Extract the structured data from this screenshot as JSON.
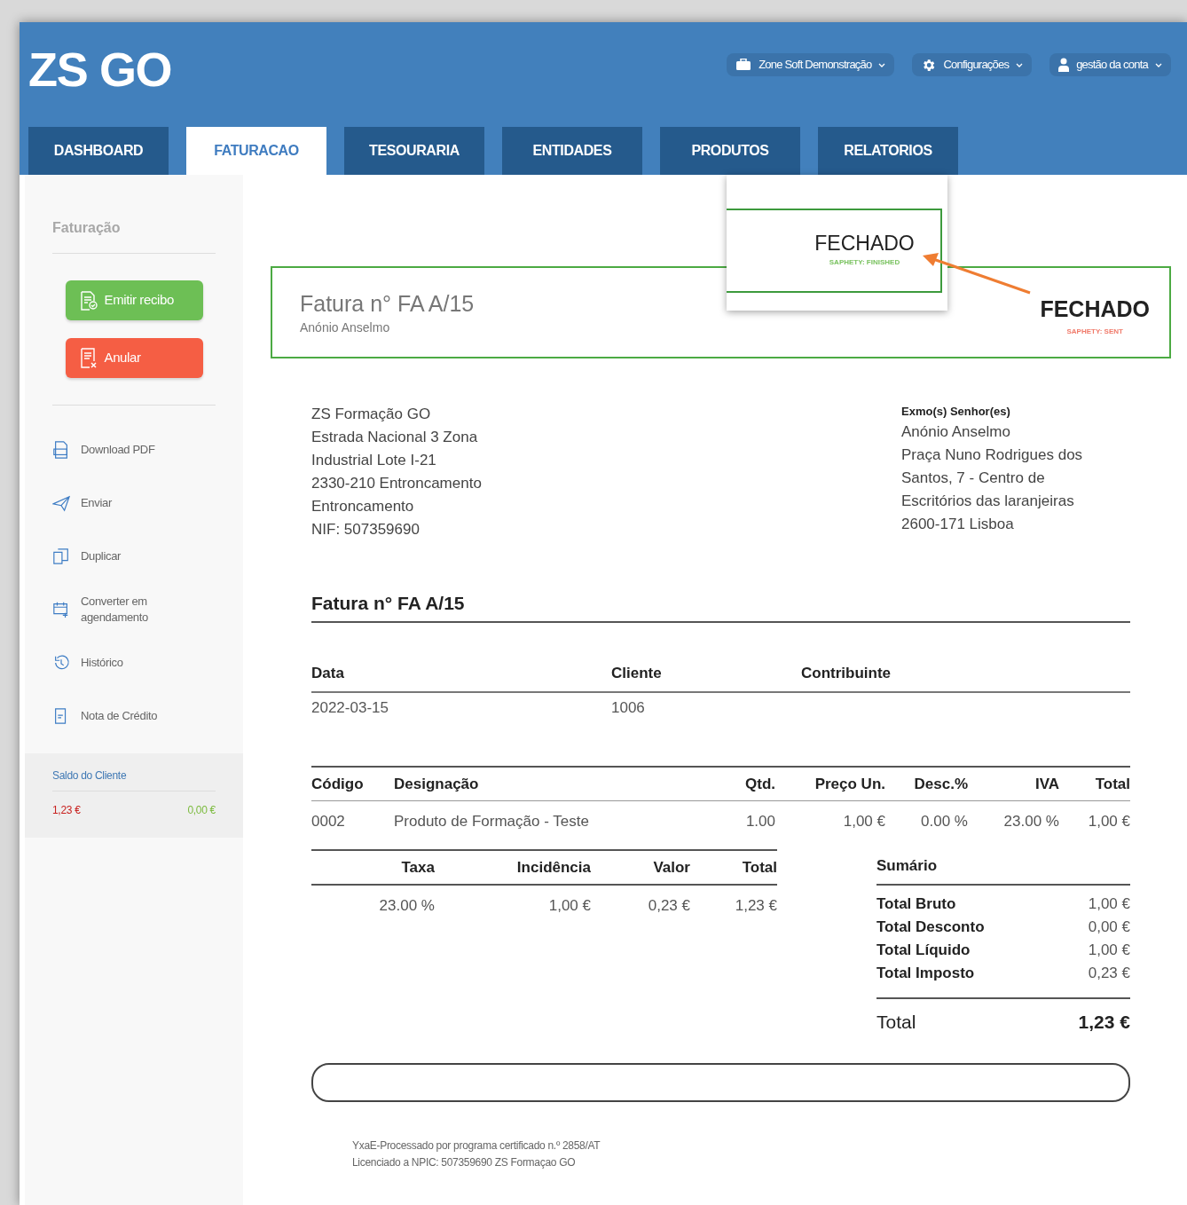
{
  "header": {
    "logo": "ZS GO",
    "menus": [
      {
        "label": "Zone Soft Demonstração",
        "kind": "company"
      },
      {
        "label": "Configurações",
        "kind": "settings"
      },
      {
        "label": "gestão da conta",
        "kind": "user"
      }
    ],
    "tabs": [
      {
        "label": "DASHBOARD",
        "selected": false
      },
      {
        "label": "FATURACAO",
        "selected": true
      },
      {
        "label": "TESOURARIA",
        "selected": false
      },
      {
        "label": "ENTIDADES",
        "selected": false
      },
      {
        "label": "PRODUTOS",
        "selected": false
      },
      {
        "label": "RELATORIOS",
        "selected": false
      }
    ]
  },
  "sidebar": {
    "title": "Faturação",
    "actions": [
      {
        "label": "Emitir recibo",
        "kind": "success"
      },
      {
        "label": "Anular",
        "kind": "danger"
      }
    ],
    "links": [
      {
        "label": "Download PDF",
        "kind": "pdf"
      },
      {
        "label": "Enviar",
        "kind": "send"
      },
      {
        "label": "Duplicar",
        "kind": "copy"
      },
      {
        "label": "Converter em agendamento",
        "kind": "calendar"
      },
      {
        "label": "Histórico",
        "kind": "history"
      },
      {
        "label": "Nota de Crédito",
        "kind": "credit"
      }
    ],
    "balance": {
      "title": "Saldo do Cliente",
      "debit": "1,23 €",
      "credit": "0,00 €"
    }
  },
  "document": {
    "status_box": {
      "title": "Fatura n° FA A/15",
      "client": "Anónio Anselmo",
      "status": "FECHADO",
      "note": "SAPHETY: SENT"
    },
    "callout": {
      "status": "FECHADO",
      "note": "SAPHETY: FINISHED"
    },
    "issuer": [
      "ZS Formação GO",
      "Estrada Nacional 3 Zona",
      "Industrial Lote I-21",
      "2330-210 Entroncamento",
      "Entroncamento",
      "NIF: 507359690"
    ],
    "recipient": {
      "heading": "Exmo(s) Senhor(es)",
      "lines": [
        "Anónio Anselmo",
        "Praça Nuno Rodrigues dos",
        "Santos, 7 - Centro de",
        "Escritórios das laranjeiras",
        "2600-171 Lisboa"
      ]
    },
    "doc_title": "Fatura n° FA A/15",
    "info": {
      "columns": [
        "Data",
        "Cliente",
        "Contribuinte"
      ],
      "row": [
        "2022-03-15",
        "1006"
      ]
    },
    "items": {
      "columns": [
        "Código",
        "Designação",
        "Qtd.",
        "Preço Un.",
        "Desc.%",
        "IVA",
        "Total"
      ],
      "rows": [
        [
          "0002",
          "Produto de Formação - Teste",
          "1.00",
          "1,00 €",
          "0.00 %",
          "23.00 %",
          "1,00 €"
        ]
      ]
    },
    "taxes": {
      "columns": [
        "Taxa",
        "Incidência",
        "Valor",
        "Total"
      ],
      "rows": [
        [
          "23.00 %",
          "1,00 €",
          "0,23 €",
          "1,23 €"
        ]
      ]
    },
    "summary": {
      "heading": "Sumário",
      "rows": [
        {
          "label": "Total Bruto",
          "value": "1,00 €"
        },
        {
          "label": "Total Desconto",
          "value": "0,00 €"
        },
        {
          "label": "Total Líquido",
          "value": "1,00 €"
        },
        {
          "label": "Total Imposto",
          "value": "0,23 €"
        }
      ],
      "total_label": "Total",
      "total_value": "1,23 €"
    },
    "footer": [
      "YxaE-Processado por programa certificado n.º 2858/AT",
      "Licenciado a NPIC: 507359690 ZS Formaçao GO"
    ]
  }
}
